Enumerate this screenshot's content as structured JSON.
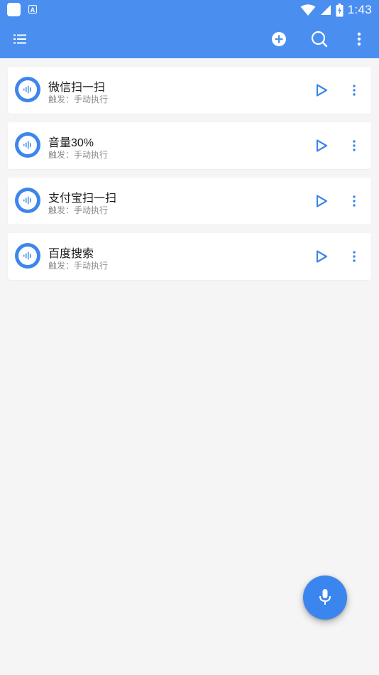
{
  "colors": {
    "appbar": "#4a8ff0",
    "accent": "#3d86ec",
    "background": "#f5f5f5",
    "card": "#ffffff"
  },
  "status_bar": {
    "time": "1:43",
    "left_icons": [
      "notification-app-icon",
      "font-a-icon"
    ],
    "right_icons": [
      "wifi-icon",
      "cellular-signal-icon",
      "battery-charging-icon"
    ]
  },
  "toolbar": {
    "icons": [
      "list-menu-icon",
      "add-circle-icon",
      "search-icon",
      "more-vertical-icon"
    ]
  },
  "commands": [
    {
      "title": "微信扫一扫",
      "subtitle": "触发：手动执行",
      "icon": "voice-bubble-icon"
    },
    {
      "title": "音量30%",
      "subtitle": "触发：手动执行",
      "icon": "voice-bubble-icon"
    },
    {
      "title": "支付宝扫一扫",
      "subtitle": "触发：手动执行",
      "icon": "voice-bubble-icon"
    },
    {
      "title": "百度搜索",
      "subtitle": "触发：手动执行",
      "icon": "voice-bubble-icon"
    }
  ],
  "fab": {
    "icon": "microphone-icon"
  }
}
